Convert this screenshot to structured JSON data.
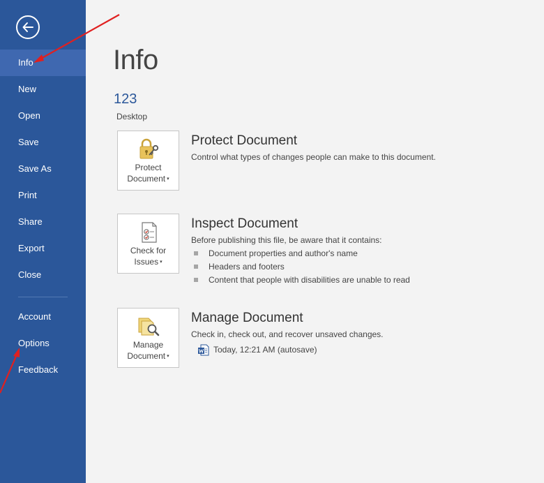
{
  "sidebar": {
    "items": [
      {
        "label": "Info"
      },
      {
        "label": "New"
      },
      {
        "label": "Open"
      },
      {
        "label": "Save"
      },
      {
        "label": "Save As"
      },
      {
        "label": "Print"
      },
      {
        "label": "Share"
      },
      {
        "label": "Export"
      },
      {
        "label": "Close"
      },
      {
        "label": "Account"
      },
      {
        "label": "Options"
      },
      {
        "label": "Feedback"
      }
    ],
    "active": "Info"
  },
  "main": {
    "title": "Info",
    "document_name": "123",
    "document_location": "Desktop",
    "protect": {
      "button_line1": "Protect",
      "button_line2": "Document",
      "title": "Protect Document",
      "description": "Control what types of changes people can make to this document."
    },
    "inspect": {
      "button_line1": "Check for",
      "button_line2": "Issues",
      "title": "Inspect Document",
      "description": "Before publishing this file, be aware that it contains:",
      "bullets": [
        "Document properties and author's name",
        "Headers and footers",
        "Content that people with disabilities are unable to read"
      ]
    },
    "manage": {
      "button_line1": "Manage",
      "button_line2": "Document",
      "title": "Manage Document",
      "description": "Check in, check out, and recover unsaved changes.",
      "version": "Today, 12:21 AM (autosave)"
    }
  },
  "colors": {
    "sidebar": "#2b579a",
    "sidebar_active": "#3f68b0",
    "accent": "#2b579a",
    "annotation_arrow": "#e02020"
  }
}
